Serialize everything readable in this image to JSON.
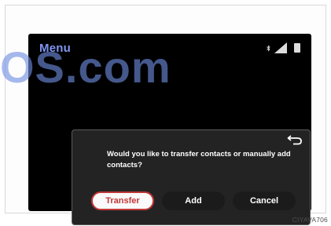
{
  "header": {
    "title": "Menu"
  },
  "status_icons": [
    "bluetooth-icon",
    "signal-icon",
    "battery-icon"
  ],
  "watermark": {
    "text": "OS.com"
  },
  "dialog": {
    "message": "Would you like to transfer contacts or manually add contacts?",
    "buttons": [
      "Transfer",
      "Add",
      "Cancel"
    ],
    "selected_button": "Transfer"
  },
  "caption": "CIYAVA706",
  "colors": {
    "menu_title": "#7f95f2",
    "selected_button_text": "#c23838",
    "screen_background": "#000000",
    "dialog_background": "#232323"
  }
}
